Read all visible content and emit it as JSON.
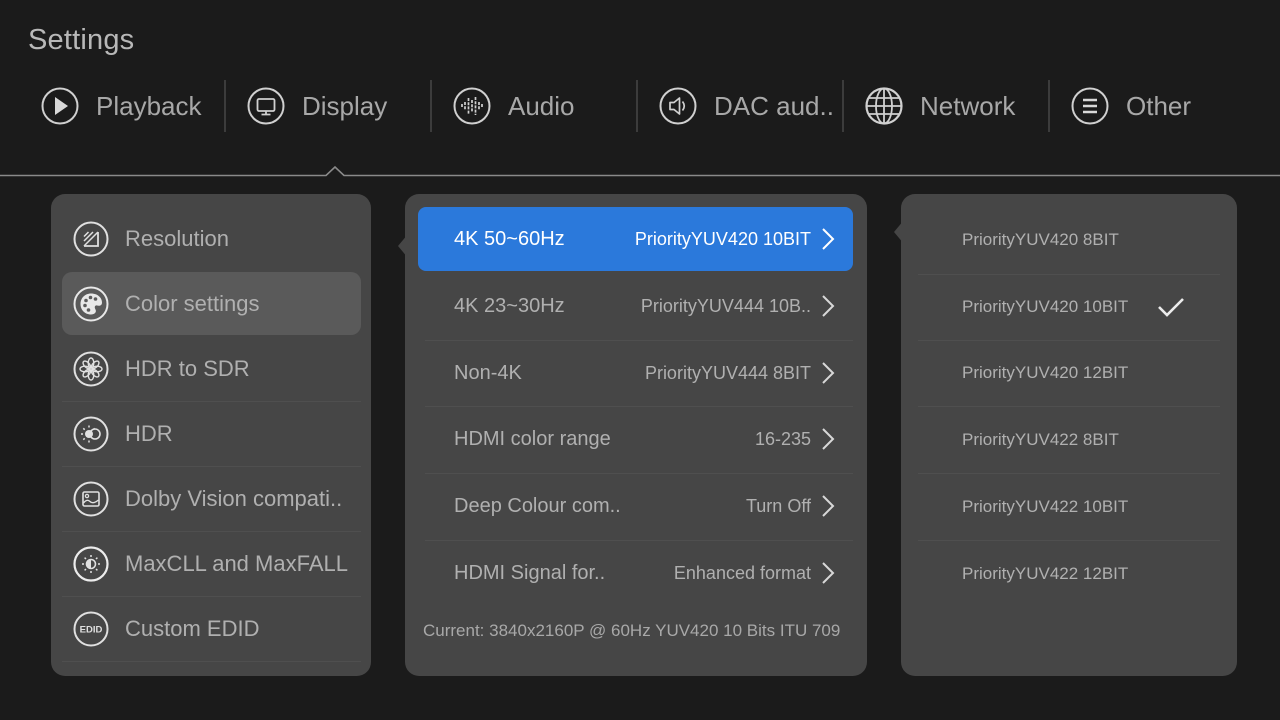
{
  "header": {
    "title": "Settings"
  },
  "tabs": [
    {
      "label": "Playback",
      "icon": "play-icon"
    },
    {
      "label": "Display",
      "icon": "monitor-icon",
      "active": true
    },
    {
      "label": "Audio",
      "icon": "audio-wave-icon"
    },
    {
      "label": "DAC aud..",
      "icon": "speaker-icon"
    },
    {
      "label": "Network",
      "icon": "globe-icon"
    },
    {
      "label": "Other",
      "icon": "menu-icon"
    }
  ],
  "display_menu": {
    "items": [
      {
        "label": "Resolution",
        "icon": "resolution-icon"
      },
      {
        "label": "Color settings",
        "icon": "palette-icon",
        "selected": true
      },
      {
        "label": "HDR to SDR",
        "icon": "flower-icon"
      },
      {
        "label": "HDR",
        "icon": "hdr-icon"
      },
      {
        "label": "Dolby Vision compati..",
        "icon": "image-icon"
      },
      {
        "label": "MaxCLL and MaxFALL",
        "icon": "brightness-icon"
      },
      {
        "label": "Custom EDID",
        "icon": "edid-icon"
      }
    ]
  },
  "color_settings": {
    "items": [
      {
        "label": "4K 50~60Hz",
        "value": "PriorityYUV420 10BIT",
        "selected": true
      },
      {
        "label": "4K 23~30Hz",
        "value": "PriorityYUV444 10B.."
      },
      {
        "label": "Non-4K",
        "value": "PriorityYUV444 8BIT"
      },
      {
        "label": "HDMI color range",
        "value": "16-235"
      },
      {
        "label": "Deep Colour com..",
        "value": "Turn Off"
      },
      {
        "label": "HDMI Signal for..",
        "value": "Enhanced format"
      }
    ],
    "current": "Current: 3840x2160P @ 60Hz  YUV420  10 Bits  ITU 709"
  },
  "options": {
    "items": [
      {
        "label": "PriorityYUV420 8BIT",
        "checked": false
      },
      {
        "label": "PriorityYUV420 10BIT",
        "checked": true
      },
      {
        "label": "PriorityYUV420 12BIT",
        "checked": false
      },
      {
        "label": "PriorityYUV422 8BIT",
        "checked": false
      },
      {
        "label": "PriorityYUV422 10BIT",
        "checked": false
      },
      {
        "label": "PriorityYUV422 12BIT",
        "checked": false
      }
    ]
  },
  "colors": {
    "accent": "#2b79db",
    "background": "#1b1b1b",
    "panel": "#464646",
    "selected_row": "#5a5a5a"
  }
}
